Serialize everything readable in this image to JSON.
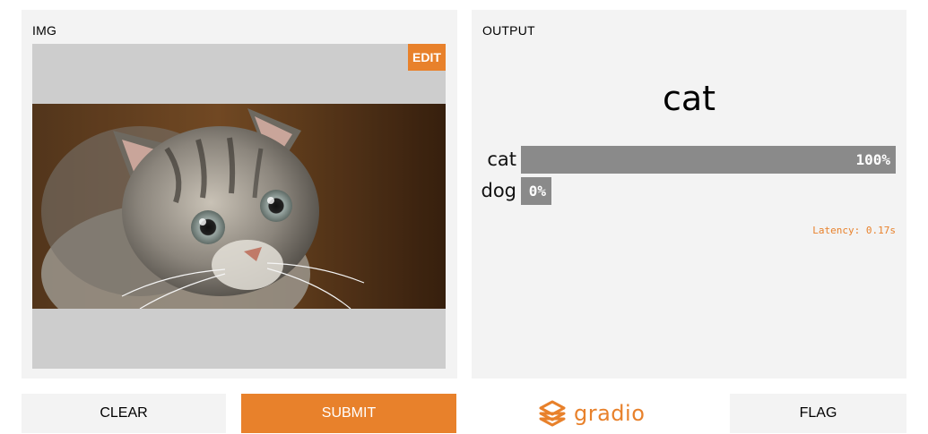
{
  "input": {
    "label": "IMG",
    "edit_label": "EDIT",
    "image_subject": "tabby kitten looking up"
  },
  "output": {
    "label": "OUTPUT",
    "predicted": "cat",
    "confidences": [
      {
        "label": "cat",
        "fraction": 1.0,
        "display": "100%"
      },
      {
        "label": "dog",
        "fraction": 0.0,
        "display": "0%"
      }
    ],
    "latency": "Latency: 0.17s"
  },
  "buttons": {
    "clear": "CLEAR",
    "submit": "SUBMIT",
    "flag": "FLAG"
  },
  "brand": {
    "name": "gradio",
    "logo_icon": "gradio-logo-icon"
  },
  "colors": {
    "accent": "#e8812b",
    "panel": "#f3f3f3",
    "image_bg": "#cdcdcd",
    "bar": "#8a8a8a"
  }
}
